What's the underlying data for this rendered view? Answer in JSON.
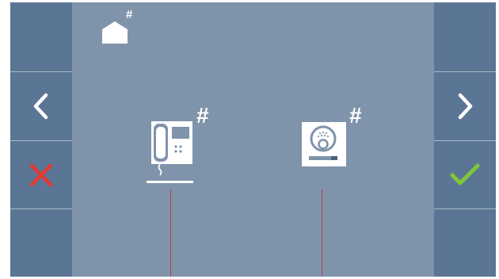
{
  "screen": {
    "home": {
      "icon": "home-icon",
      "hash": "#"
    },
    "devices": [
      {
        "name": "handset-monitor",
        "icon": "intercom-handset-icon",
        "hash": "#",
        "selected": true
      },
      {
        "name": "entrance-panel",
        "icon": "door-panel-camera-icon",
        "hash": "#",
        "selected": false
      }
    ]
  },
  "sidebar_left": {
    "buttons": [
      "empty",
      "back-icon",
      "cancel-icon",
      "empty"
    ]
  },
  "sidebar_right": {
    "buttons": [
      "empty",
      "forward-icon",
      "confirm-icon",
      "empty"
    ]
  },
  "colors": {
    "background": "#7f93ab",
    "sidebar": "#5b7694",
    "cancel": "#e23a33",
    "confirm": "#7fc63a",
    "wire": "#b93c48"
  }
}
